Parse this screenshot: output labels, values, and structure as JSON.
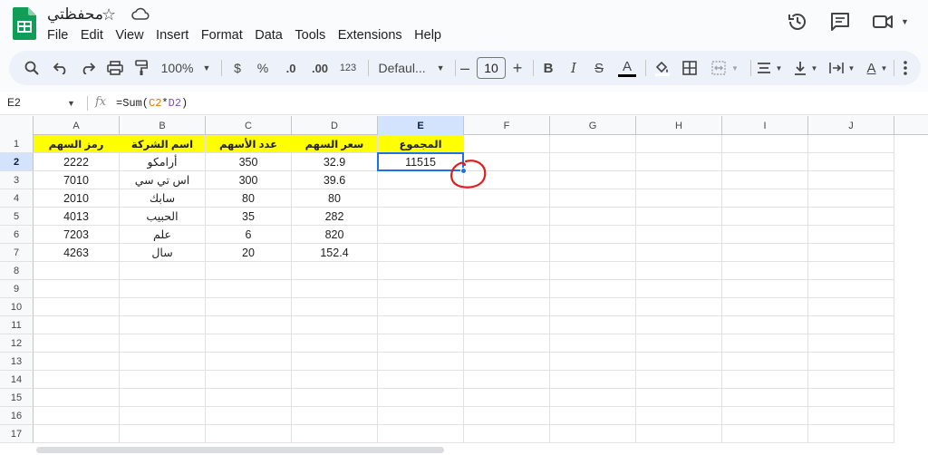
{
  "app": {
    "title": "محفظتي",
    "menus": [
      "File",
      "Edit",
      "View",
      "Insert",
      "Format",
      "Data",
      "Tools",
      "Extensions",
      "Help"
    ]
  },
  "toolbar": {
    "zoom": "100%",
    "currency": "$",
    "percent": "%",
    "decrease_decimal": ".0",
    "increase_decimal": ".00",
    "number_format": "123",
    "font": "Defaul...",
    "font_size": "10",
    "minus": "–",
    "plus": "+",
    "bold": "B",
    "italic": "I",
    "strike": "S",
    "text_color_letter": "A",
    "highlight_letter": "A",
    "icons": [
      "search-icon",
      "undo-icon",
      "redo-icon",
      "print-icon",
      "paint-format-icon",
      "fill-color-icon",
      "borders-icon",
      "merge-cells-icon",
      "align-icon",
      "vertical-align-icon",
      "text-wrap-icon",
      "text-rotation-icon",
      "more-icon"
    ]
  },
  "formula_bar": {
    "cell_ref": "E2",
    "fx": "fx",
    "formula_prefix": "=Sum(",
    "ref1": "C2",
    "operator": "*",
    "ref2": "D2",
    "formula_suffix": ")"
  },
  "sheet": {
    "columns": [
      "A",
      "B",
      "C",
      "D",
      "E",
      "F",
      "G",
      "H",
      "I",
      "J"
    ],
    "rows": [
      "1",
      "2",
      "3",
      "4",
      "5",
      "6",
      "7",
      "8",
      "9",
      "10",
      "11",
      "12",
      "13",
      "14",
      "15",
      "16",
      "17"
    ],
    "selected_cell": "E2",
    "headers": [
      "رمز السهم",
      "اسم الشركة",
      "عدد الأسهم",
      "سعر السهم",
      "المجموع"
    ],
    "data": [
      [
        "2222",
        "أرامكو",
        "350",
        "32.9",
        "11515"
      ],
      [
        "7010",
        "اس تي سي",
        "300",
        "39.6",
        ""
      ],
      [
        "2010",
        "سابك",
        "80",
        "80",
        ""
      ],
      [
        "4013",
        "الحبيب",
        "35",
        "282",
        ""
      ],
      [
        "7203",
        "علم",
        "6",
        "820",
        ""
      ],
      [
        "4263",
        "سال",
        "20",
        "152.4",
        ""
      ]
    ]
  },
  "colors": {
    "header_fill": "#ffff00",
    "selection": "#1a73e8",
    "annotation": "#e01c1c",
    "logo": "#0f9d58"
  }
}
